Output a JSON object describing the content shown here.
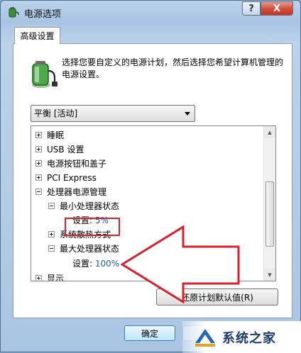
{
  "window": {
    "title": "电源选项",
    "help_label": "?",
    "close_label": "X"
  },
  "tab": {
    "label": "高级设置"
  },
  "description": "选择您要自定义的电源计划，然后选择您希望计算机管理的电源设置。",
  "plan_select": {
    "value": "平衡 [活动]"
  },
  "tree": {
    "items": [
      {
        "label": "睡眠"
      },
      {
        "label": "USB 设置"
      },
      {
        "label": "电源按钮和盖子"
      },
      {
        "label": "PCI Express"
      },
      {
        "label": "处理器电源管理"
      },
      {
        "label": "最小处理器状态"
      },
      {
        "label": "设置:",
        "value": "5%"
      },
      {
        "label": "系统散热方式"
      },
      {
        "label": "最大处理器状态"
      },
      {
        "label": "设置:",
        "value": "100%"
      },
      {
        "label": "显示"
      }
    ]
  },
  "buttons": {
    "restore_label": "还原计划默认值(R)",
    "ok_label": "确定"
  },
  "watermark": {
    "text": "系统之家"
  },
  "colors": {
    "highlight": "#d8202a",
    "value_text": "#1e5eb4"
  },
  "icons": {
    "title": "battery-plug-icon",
    "main": "battery-plug-icon",
    "watermark": "xitongzhijia-logo-icon"
  }
}
